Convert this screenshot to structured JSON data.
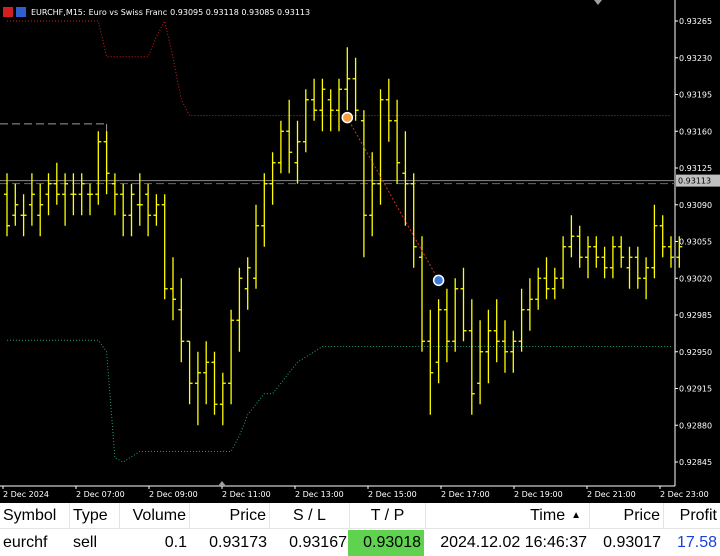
{
  "chart_header": {
    "symbol": "EURCHF,M15:",
    "description": "Euro vs Swiss Franc",
    "ohlc": "0.93095 0.93118 0.93085 0.93113"
  },
  "colors": {
    "background": "#000000",
    "candles": "#ffff00",
    "upper_band": "#c8201c",
    "lower_band": "#1fa07a",
    "price_line": "#8a8a8a",
    "tp_highlight": "#5fd34f",
    "profit": "#1a3fe0"
  },
  "chart_data": {
    "type": "line",
    "symbol": "EURCHF",
    "timeframe": "M15",
    "ylim": [
      0.9282,
      0.9327
    ],
    "y_ticks": [
      "0.93265",
      "0.93230",
      "0.93195",
      "0.93160",
      "0.93125",
      "0.93090",
      "0.93055",
      "0.93020",
      "0.92985",
      "0.92950",
      "0.92915",
      "0.92880",
      "0.92845"
    ],
    "current_price_label": "0.93113",
    "x_ticks": [
      "2 Dec 2024",
      "2 Dec 07:00",
      "2 Dec 09:00",
      "2 Dec 11:00",
      "2 Dec 13:00",
      "2 Dec 15:00",
      "2 Dec 17:00",
      "2 Dec 19:00",
      "2 Dec 21:00",
      "2 Dec 23:00"
    ],
    "bars": [
      [
        0.931,
        0.9312,
        0.9306,
        0.9307
      ],
      [
        0.9308,
        0.9311,
        0.9307,
        0.9309
      ],
      [
        0.9308,
        0.931,
        0.9306,
        0.9308
      ],
      [
        0.9309,
        0.9312,
        0.9307,
        0.931
      ],
      [
        0.9308,
        0.9311,
        0.9306,
        0.9309
      ],
      [
        0.931,
        0.9312,
        0.9308,
        0.9311
      ],
      [
        0.9311,
        0.9313,
        0.9309,
        0.931
      ],
      [
        0.931,
        0.9312,
        0.9307,
        0.9311
      ],
      [
        0.931,
        0.9312,
        0.9308,
        0.931
      ],
      [
        0.931,
        0.9312,
        0.9308,
        0.9311
      ],
      [
        0.931,
        0.9311,
        0.9308,
        0.931
      ],
      [
        0.931,
        0.9316,
        0.9309,
        0.9315
      ],
      [
        0.9315,
        0.9316,
        0.931,
        0.9312
      ],
      [
        0.9311,
        0.9312,
        0.9308,
        0.931
      ],
      [
        0.931,
        0.9311,
        0.9306,
        0.9308
      ],
      [
        0.9308,
        0.9311,
        0.9306,
        0.931
      ],
      [
        0.9309,
        0.9312,
        0.9307,
        0.9309
      ],
      [
        0.931,
        0.9311,
        0.9306,
        0.9308
      ],
      [
        0.9308,
        0.931,
        0.9307,
        0.9309
      ],
      [
        0.9309,
        0.931,
        0.93,
        0.9301
      ],
      [
        0.9301,
        0.9304,
        0.9298,
        0.93
      ],
      [
        0.9299,
        0.9302,
        0.9294,
        0.9296
      ],
      [
        0.9296,
        0.9296,
        0.929,
        0.9292
      ],
      [
        0.9292,
        0.9295,
        0.9288,
        0.9293
      ],
      [
        0.9293,
        0.9296,
        0.929,
        0.9294
      ],
      [
        0.9294,
        0.9295,
        0.9289,
        0.929
      ],
      [
        0.929,
        0.9293,
        0.9288,
        0.9292
      ],
      [
        0.9292,
        0.9299,
        0.929,
        0.9298
      ],
      [
        0.9298,
        0.9303,
        0.9295,
        0.9302
      ],
      [
        0.9301,
        0.9304,
        0.9299,
        0.9303
      ],
      [
        0.9302,
        0.9309,
        0.9301,
        0.9307
      ],
      [
        0.9307,
        0.9312,
        0.9305,
        0.9311
      ],
      [
        0.9311,
        0.9314,
        0.9309,
        0.9313
      ],
      [
        0.9313,
        0.9317,
        0.9312,
        0.9316
      ],
      [
        0.9316,
        0.9319,
        0.9312,
        0.9314
      ],
      [
        0.9313,
        0.9317,
        0.9311,
        0.9315
      ],
      [
        0.9315,
        0.932,
        0.9314,
        0.9319
      ],
      [
        0.9319,
        0.9321,
        0.9317,
        0.9318
      ],
      [
        0.9318,
        0.9321,
        0.9316,
        0.932
      ],
      [
        0.9319,
        0.932,
        0.9316,
        0.9318
      ],
      [
        0.9318,
        0.9321,
        0.9316,
        0.932
      ],
      [
        0.932,
        0.9324,
        0.9318,
        0.9321
      ],
      [
        0.9321,
        0.9323,
        0.9317,
        0.9318
      ],
      [
        0.9317,
        0.9318,
        0.9304,
        0.9308
      ],
      [
        0.9308,
        0.9314,
        0.9306,
        0.9311
      ],
      [
        0.9311,
        0.932,
        0.9309,
        0.9319
      ],
      [
        0.9319,
        0.9321,
        0.9315,
        0.9317
      ],
      [
        0.9317,
        0.9319,
        0.9311,
        0.9313
      ],
      [
        0.9312,
        0.9316,
        0.9307,
        0.9311
      ],
      [
        0.9311,
        0.9312,
        0.9303,
        0.9305
      ],
      [
        0.9304,
        0.9306,
        0.9295,
        0.9296
      ],
      [
        0.9296,
        0.9299,
        0.9289,
        0.9293
      ],
      [
        0.9294,
        0.93,
        0.9292,
        0.9299
      ],
      [
        0.9299,
        0.9301,
        0.9294,
        0.9296
      ],
      [
        0.9296,
        0.9302,
        0.9295,
        0.9301
      ],
      [
        0.9301,
        0.9303,
        0.9296,
        0.9297
      ],
      [
        0.9297,
        0.93,
        0.9289,
        0.9291
      ],
      [
        0.9292,
        0.9298,
        0.929,
        0.9295
      ],
      [
        0.9295,
        0.9299,
        0.9292,
        0.9297
      ],
      [
        0.9297,
        0.93,
        0.9294,
        0.9296
      ],
      [
        0.9296,
        0.9298,
        0.9293,
        0.9295
      ],
      [
        0.9295,
        0.9297,
        0.9293,
        0.9296
      ],
      [
        0.9296,
        0.9301,
        0.9295,
        0.9299
      ],
      [
        0.9299,
        0.9302,
        0.9297,
        0.93
      ],
      [
        0.93,
        0.9303,
        0.9299,
        0.9302
      ],
      [
        0.9302,
        0.9304,
        0.93,
        0.9301
      ],
      [
        0.9301,
        0.9303,
        0.93,
        0.9302
      ],
      [
        0.9302,
        0.9306,
        0.9301,
        0.9305
      ],
      [
        0.9305,
        0.9308,
        0.9304,
        0.9306
      ],
      [
        0.9306,
        0.9307,
        0.9303,
        0.9304
      ],
      [
        0.9304,
        0.9306,
        0.9302,
        0.9305
      ],
      [
        0.9305,
        0.9306,
        0.9303,
        0.9304
      ],
      [
        0.9304,
        0.9305,
        0.9302,
        0.9303
      ],
      [
        0.9303,
        0.9306,
        0.9302,
        0.9305
      ],
      [
        0.9305,
        0.9306,
        0.9303,
        0.9304
      ],
      [
        0.9303,
        0.9305,
        0.9301,
        0.9304
      ],
      [
        0.9304,
        0.9305,
        0.9301,
        0.9302
      ],
      [
        0.9302,
        0.9304,
        0.93,
        0.9303
      ],
      [
        0.9303,
        0.9309,
        0.9302,
        0.9307
      ],
      [
        0.9307,
        0.9308,
        0.9304,
        0.9305
      ],
      [
        0.9305,
        0.9306,
        0.9303,
        0.9304
      ],
      [
        0.9304,
        0.9306,
        0.9303,
        0.9305
      ]
    ],
    "upper_band": [
      [
        0,
        0.93265
      ],
      [
        1,
        0.93265
      ],
      [
        2,
        0.93265
      ],
      [
        3,
        0.93265
      ],
      [
        4,
        0.93265
      ],
      [
        5,
        0.93265
      ],
      [
        6,
        0.93265
      ],
      [
        7,
        0.93265
      ],
      [
        8,
        0.93265
      ],
      [
        9,
        0.93265
      ],
      [
        10,
        0.93265
      ],
      [
        11,
        0.93265
      ],
      [
        12,
        0.93231
      ],
      [
        13,
        0.93231
      ],
      [
        14,
        0.93231
      ],
      [
        15,
        0.93231
      ],
      [
        16,
        0.93231
      ],
      [
        17,
        0.93231
      ],
      [
        18,
        0.9325
      ],
      [
        19,
        0.93265
      ],
      [
        20,
        0.9323
      ],
      [
        21,
        0.9319
      ],
      [
        22,
        0.93175
      ],
      [
        23,
        0.93175
      ],
      [
        80,
        0.93175
      ]
    ],
    "lower_band": [
      [
        0,
        0.92961
      ],
      [
        11,
        0.92961
      ],
      [
        12,
        0.9295
      ],
      [
        13,
        0.92849
      ],
      [
        14,
        0.92845
      ],
      [
        15,
        0.9285
      ],
      [
        16,
        0.92855
      ],
      [
        17,
        0.92855
      ],
      [
        27,
        0.92855
      ],
      [
        28,
        0.9287
      ],
      [
        29,
        0.9289
      ],
      [
        30,
        0.929
      ],
      [
        31,
        0.9291
      ],
      [
        32,
        0.9291
      ],
      [
        33,
        0.9292
      ],
      [
        34,
        0.9293
      ],
      [
        35,
        0.9294
      ],
      [
        36,
        0.92945
      ],
      [
        37,
        0.9295
      ],
      [
        38,
        0.92955
      ],
      [
        80,
        0.92955
      ]
    ],
    "dashed_level": {
      "value": 0.93167,
      "from_bar": 0,
      "to_bar": 12
    },
    "trade_line": {
      "from_bar": 41,
      "to_bar": 52,
      "from_price": 0.93173,
      "to_price": 0.93018
    },
    "current_price": 0.93113
  },
  "trade_table": {
    "headers": {
      "symbol": "Symbol",
      "type": "Type",
      "volume": "Volume",
      "price": "Price",
      "sl": "S / L",
      "tp": "T / P",
      "time": "Time",
      "price_current": "Price",
      "profit": "Profit"
    },
    "sort_indicator": "▲",
    "rows": [
      {
        "symbol": "eurchf",
        "type": "sell",
        "volume": "0.1",
        "price": "0.93173",
        "sl": "0.93167",
        "tp": "0.93018",
        "time": "2024.12.02 16:46:37",
        "price_current": "0.93017",
        "profit": "17.58"
      }
    ]
  }
}
